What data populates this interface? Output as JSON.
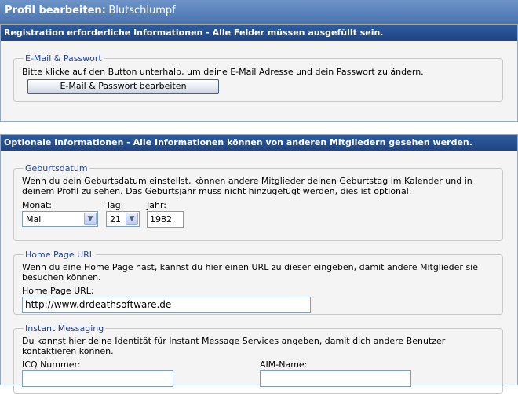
{
  "header": {
    "title": "Profil bearbeiten:",
    "username": "Blutschlumpf"
  },
  "required": {
    "heading": "Registration erforderliche Informationen - Alle Felder müssen ausgefüllt sein.",
    "email_section": {
      "legend": "E-Mail & Passwort",
      "description": "Bitte klicke auf den Button unterhalb, um deine E-Mail Adresse und dein Passwort zu ändern.",
      "button_label": "E-Mail & Passwort bearbeiten"
    }
  },
  "optional": {
    "heading": "Optionale Informationen - Alle Informationen können von anderen Mitgliedern gesehen werden.",
    "birthday": {
      "legend": "Geburtsdatum",
      "description": "Wenn du dein Geburtsdatum einstellst, können andere Mitglieder deinen Geburtstag im Kalender und in deinem Profil zu sehen. Das Geburtsjahr muss nicht hinzugefügt werden, dies ist optional.",
      "month_label": "Monat:",
      "month_value": "Mai",
      "day_label": "Tag:",
      "day_value": "21",
      "year_label": "Jahr:",
      "year_value": "1982"
    },
    "homepage": {
      "legend": "Home Page URL",
      "description": "Wenn du eine Home Page hast, kannst du hier einen URL zu dieser eingeben, damit andere Mitglieder sie besuchen können.",
      "field_label": "Home Page URL:",
      "field_value": "http://www.drdeathsoftware.de"
    },
    "im": {
      "legend": "Instant Messaging",
      "description": "Du kannst hier deine Identität für Instant Message Services angeben, damit dich andere Benutzer kontaktieren können.",
      "icq_label": "ICQ Nummer:",
      "icq_value": "",
      "aim_label": "AIM-Name:",
      "aim_value": ""
    }
  }
}
